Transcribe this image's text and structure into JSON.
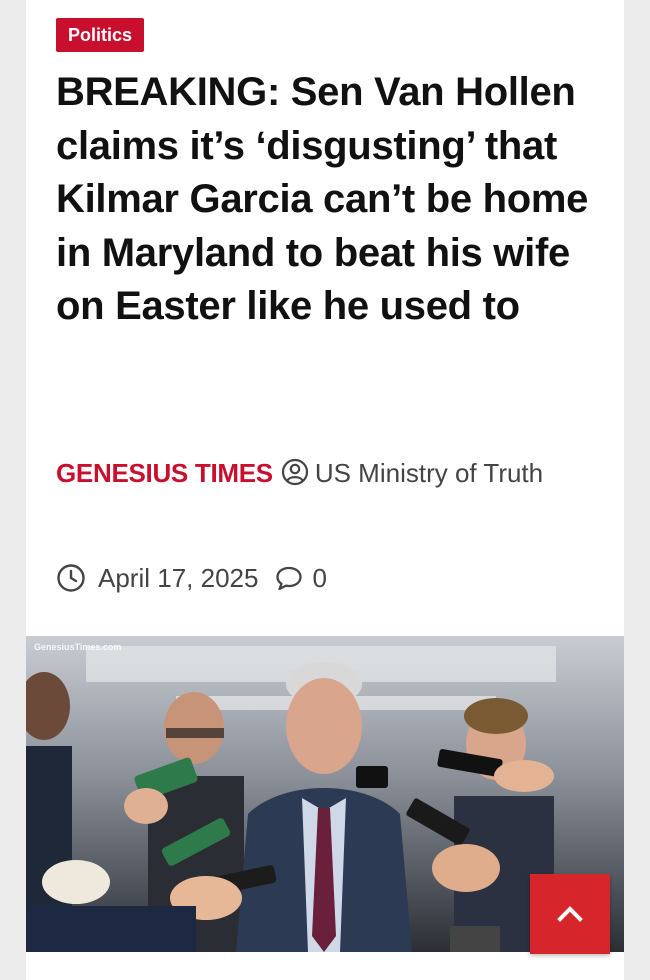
{
  "article": {
    "category": "Politics",
    "headline": "BREAKING: Sen Van Hollen claims it’s ‘disgusting’ that Kilmar Garcia can’t be home in Maryland to beat his wife on Easter like he used to",
    "source": "GENESIUS TIMES",
    "author": "US Ministry of Truth",
    "date": "April 17, 2025",
    "comment_count": "0"
  },
  "photo": {
    "watermark": "GenesiusTimes.com"
  },
  "icons": {
    "author": "user-circle-icon",
    "date": "clock-icon",
    "comments": "comment-bubble-icon",
    "scroll_top": "chevron-up-icon"
  },
  "colors": {
    "accent": "#c8102e",
    "scroll_button": "#d7262b",
    "text": "#111111",
    "meta_text": "#444444"
  }
}
